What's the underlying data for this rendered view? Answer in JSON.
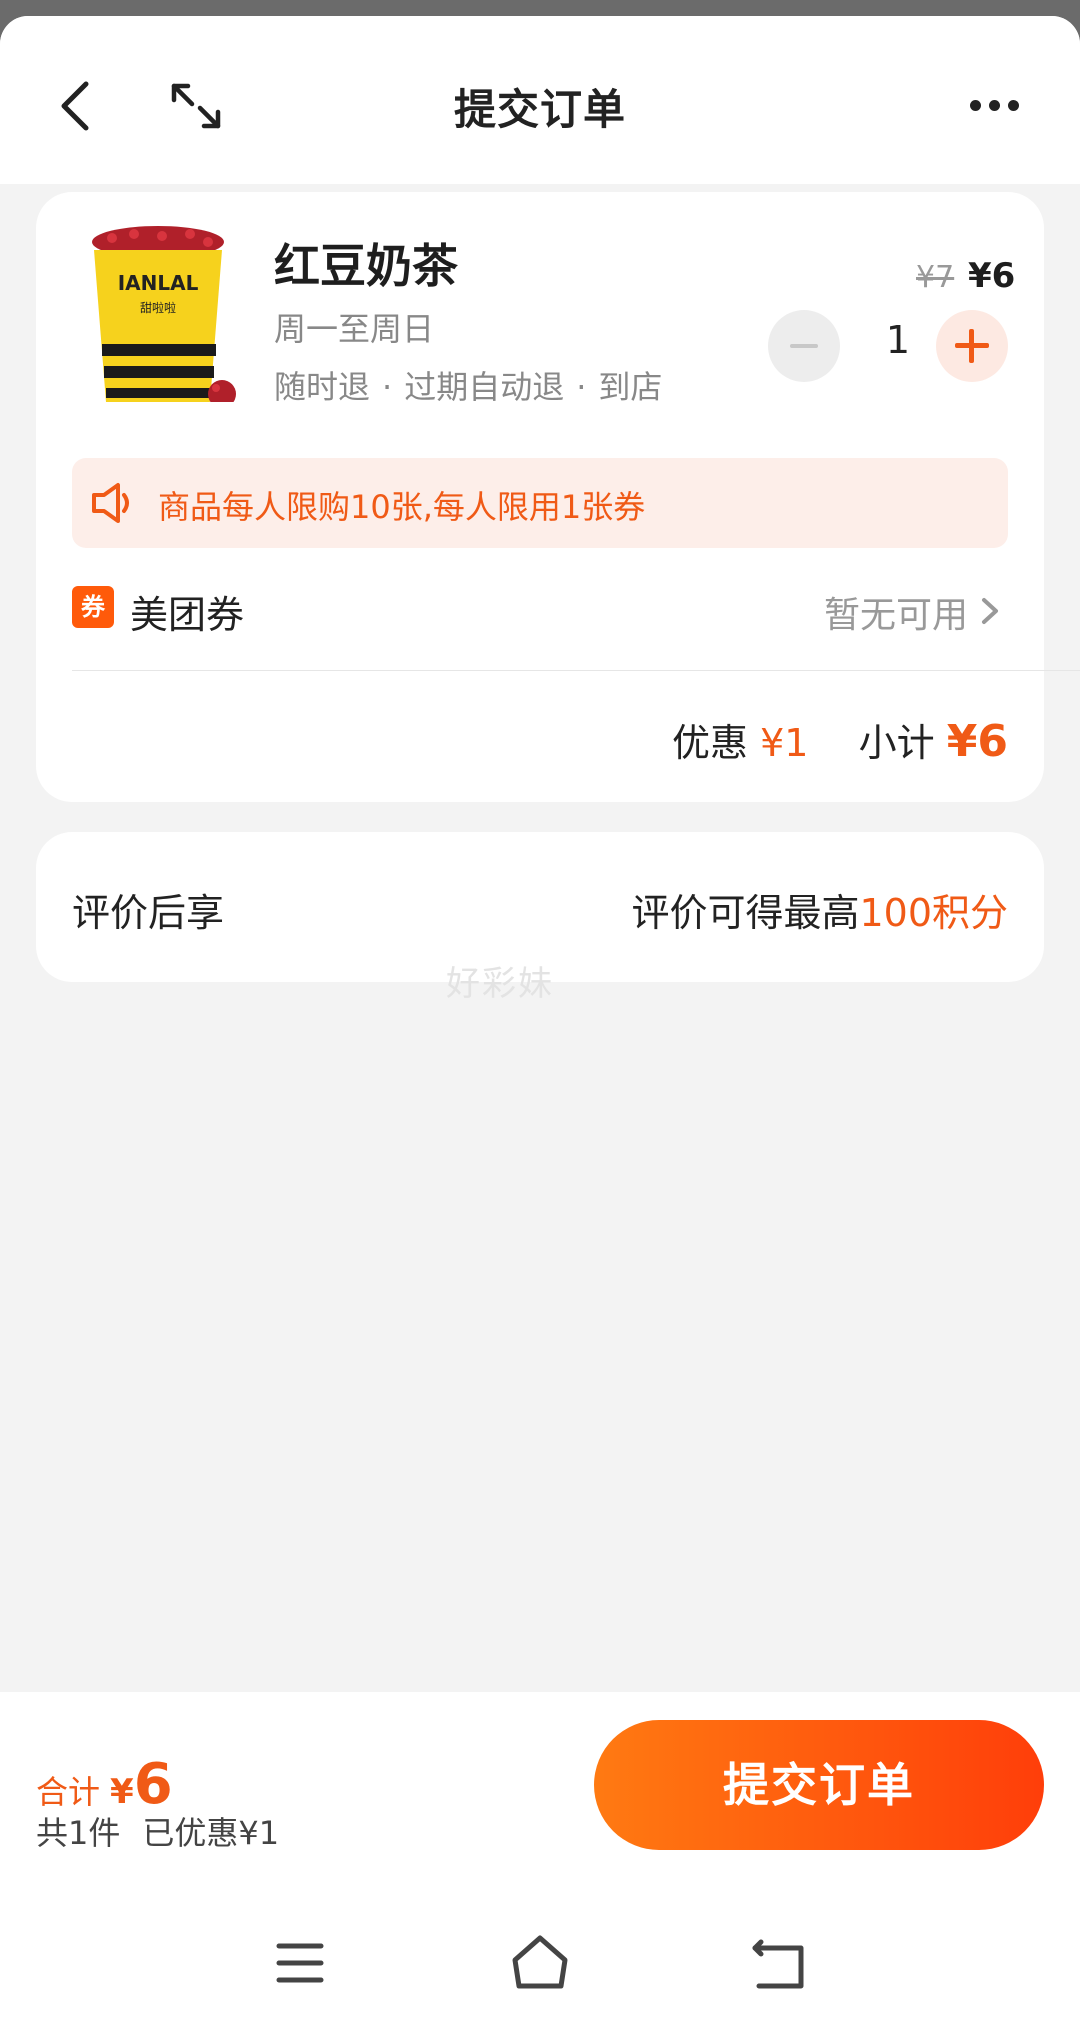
{
  "header": {
    "title": "提交订单",
    "back_icon": "chevron-left-icon",
    "expand_icon": "expand-icon",
    "more_icon": "more-horizontal-icon"
  },
  "product": {
    "name": "红豆奶茶",
    "validity": "周一至周日",
    "tags": [
      "随时退",
      "过期自动退",
      "到店"
    ],
    "original_price": "¥7",
    "price": "¥6",
    "quantity": "1",
    "image_brand_text": "TIANLALA 甜啦啦"
  },
  "notice": {
    "text": "商品每人限购10张,每人限用1张券",
    "icon": "speaker-icon"
  },
  "coupon": {
    "badge": "券",
    "label": "美团券",
    "value": "暂无可用"
  },
  "summary": {
    "discount_label": "优惠",
    "discount_value": "¥1",
    "subtotal_label": "小计",
    "subtotal_value": "¥6"
  },
  "review": {
    "label": "评价后享",
    "reward_prefix": "评价可得最高",
    "reward_value": "100积分"
  },
  "watermark": "好彩妹",
  "bottom": {
    "total_label": "合计",
    "total_currency": "¥",
    "total_amount": "6",
    "count_text": "共1件",
    "saved_text": "已优惠¥1",
    "submit_label": "提交订单"
  },
  "colors": {
    "accent": "#f05a16",
    "button_start": "#ff7a12",
    "button_end": "#ff3e0a",
    "background": "#f3f3f3"
  },
  "system_nav": {
    "icons": [
      "menu-icon",
      "home-icon",
      "back-icon"
    ]
  }
}
